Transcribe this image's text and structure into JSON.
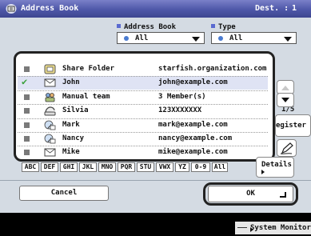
{
  "title": "Address Book",
  "dest": {
    "label": "Dest. :",
    "count": "1"
  },
  "filters": {
    "address_book": {
      "label": "Address Book",
      "value": "All"
    },
    "type": {
      "label": "Type",
      "value": "All"
    }
  },
  "entries": [
    {
      "checked": false,
      "icon": "folder-icon",
      "name": "Share Folder",
      "address": "starfish.organization.com"
    },
    {
      "checked": true,
      "icon": "email-icon",
      "name": "John",
      "address": "john@example.com"
    },
    {
      "checked": false,
      "icon": "group-icon",
      "name": "Manual team",
      "address": "3 Member(s)"
    },
    {
      "checked": false,
      "icon": "fax-icon",
      "name": "Silvia",
      "address": "123XXXXXXX"
    },
    {
      "checked": false,
      "icon": "ifax-icon",
      "name": "Mark",
      "address": "mark@example.com"
    },
    {
      "checked": false,
      "icon": "ifax-icon",
      "name": "Nancy",
      "address": "nancy@example.com"
    },
    {
      "checked": false,
      "icon": "email-icon",
      "name": "Mike",
      "address": "mike@example.com"
    }
  ],
  "pagination": {
    "indicator": "1/5"
  },
  "side": {
    "register_label": "egister"
  },
  "index_tabs": [
    "ABC",
    "DEF",
    "GHI",
    "JKL",
    "MNO",
    "PQR",
    "STU",
    "VWX",
    "YZ",
    "0-9",
    "All"
  ],
  "details_label": "Details",
  "buttons": {
    "cancel": "Cancel",
    "ok": "OK"
  },
  "footer": {
    "system_monitor": "System Monitor"
  }
}
